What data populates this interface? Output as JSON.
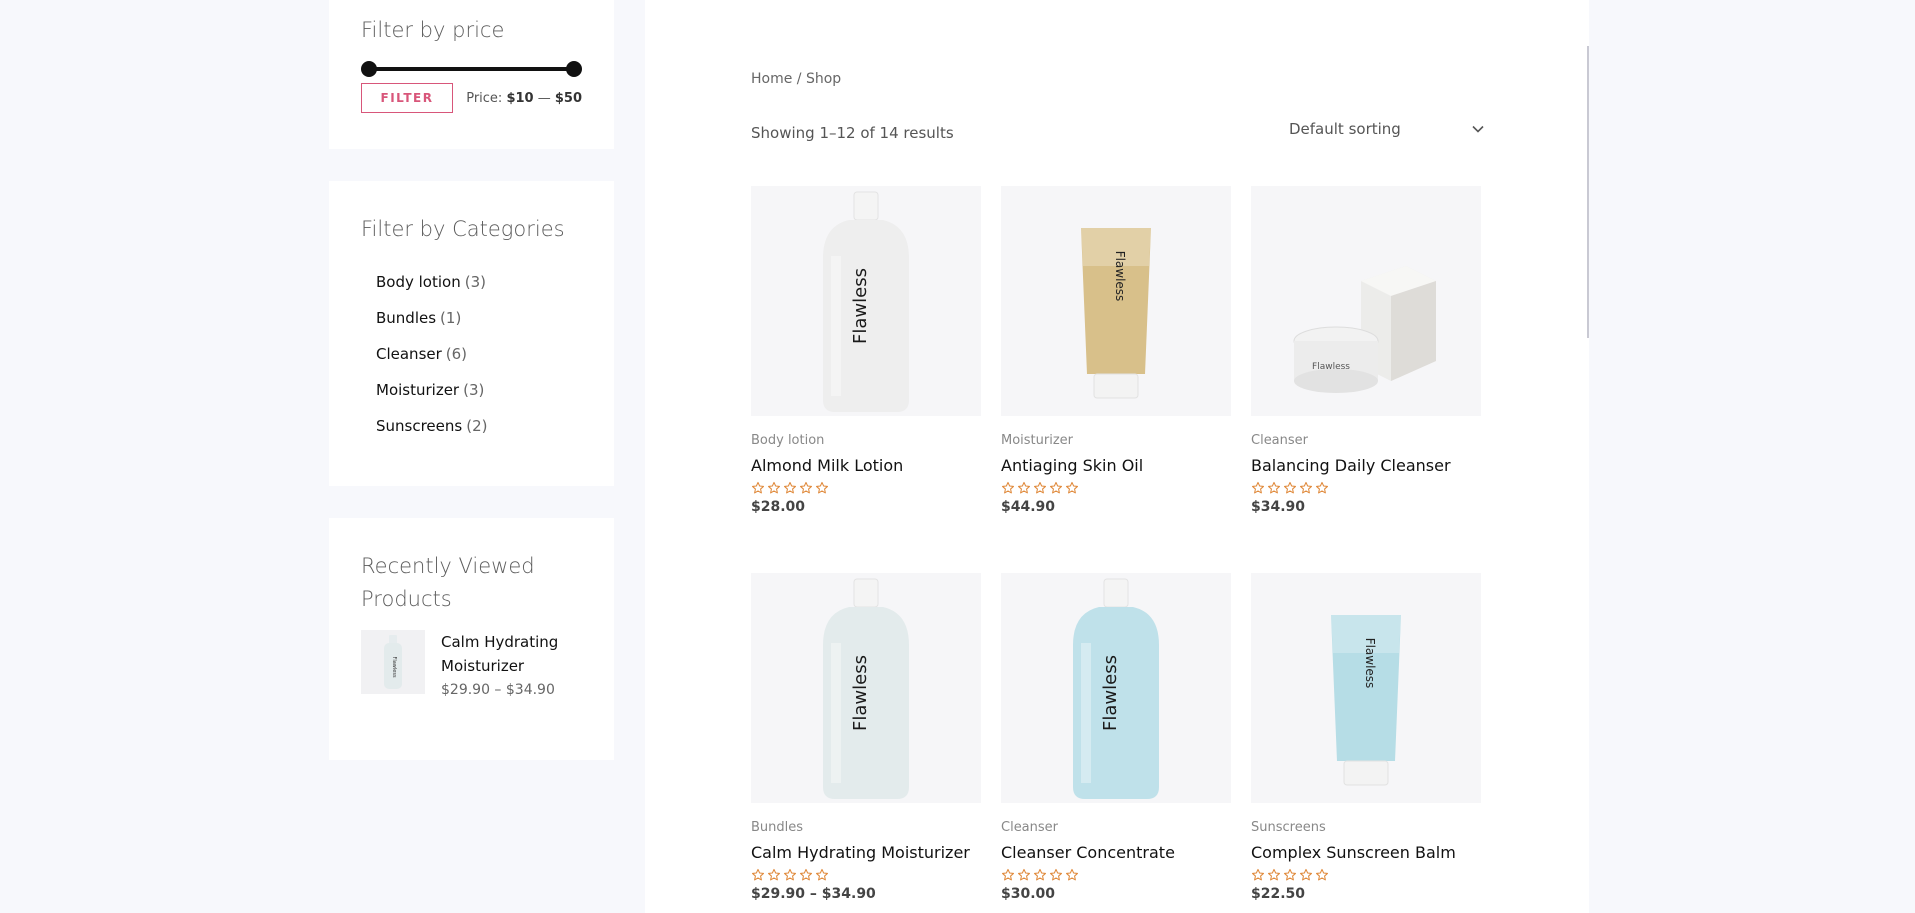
{
  "sidebar": {
    "price_filter": {
      "title": "Filter by price",
      "button_label": "FILTER",
      "price_prefix": "Price:",
      "min_price": "$10",
      "separator": "—",
      "max_price": "$50"
    },
    "categories": {
      "title": "Filter by Categories",
      "items": [
        {
          "label": "Body lotion",
          "count": "(3)"
        },
        {
          "label": "Bundles",
          "count": "(1)"
        },
        {
          "label": "Cleanser",
          "count": "(6)"
        },
        {
          "label": "Moisturizer",
          "count": "(3)"
        },
        {
          "label": "Sunscreens",
          "count": "(2)"
        }
      ]
    },
    "recently_viewed": {
      "title": "Recently Viewed Products",
      "items": [
        {
          "name": "Calm Hydrating Moisturizer",
          "price": "$29.90 – $34.90"
        }
      ]
    }
  },
  "main": {
    "breadcrumb": {
      "home": "Home",
      "separator": "/",
      "current": "Shop"
    },
    "result_count": "Showing 1–12 of 14 results",
    "sorting": {
      "selected": "Default sorting"
    },
    "products": [
      {
        "category": "Body lotion",
        "name": "Almond Milk Lotion",
        "price": "$28.00",
        "rating": 0,
        "bottle": "bottle",
        "color": "#eeeeee",
        "brand": "Flawless"
      },
      {
        "category": "Moisturizer",
        "name": "Antiaging Skin Oil",
        "price": "$44.90",
        "rating": 0,
        "bottle": "tube",
        "color": "#d8c08a",
        "brand": "Flawless"
      },
      {
        "category": "Cleanser",
        "name": "Balancing Daily Cleanser",
        "price": "$34.90",
        "rating": 0,
        "bottle": "jar",
        "color": "#e6e4e0",
        "brand": "Flawless"
      },
      {
        "category": "Bundles",
        "name": "Calm Hydrating Moisturizer",
        "price": "$29.90 – $34.90",
        "rating": 0,
        "bottle": "bottle",
        "color": "#e3ebec",
        "brand": "Flawless"
      },
      {
        "category": "Cleanser",
        "name": "Cleanser Concentrate",
        "price": "$30.00",
        "rating": 0,
        "bottle": "bottle",
        "color": "#bfe1ea",
        "brand": "Flawless"
      },
      {
        "category": "Sunscreens",
        "name": "Complex Sunscreen Balm",
        "price": "$22.50",
        "rating": 0,
        "bottle": "tube",
        "color": "#b6dde6",
        "brand": "Flawless"
      }
    ]
  },
  "colors": {
    "accent": "#d8567a",
    "star": "#e08a3c",
    "page_bg": "#f7f8fc"
  }
}
